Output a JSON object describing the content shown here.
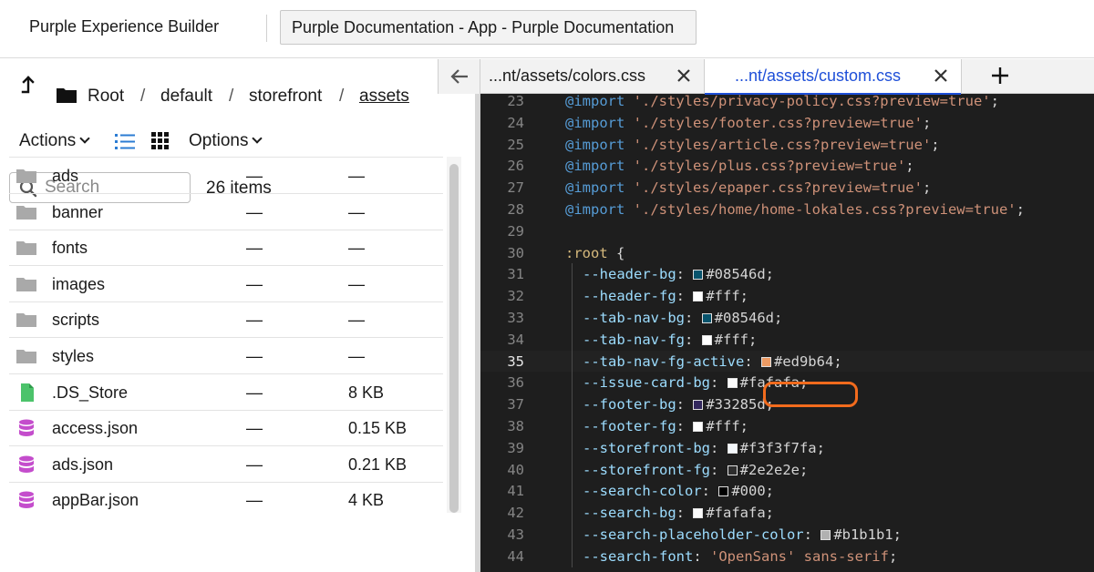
{
  "header": {
    "app_title": "Purple Experience Builder",
    "document_tab": "Purple Documentation - App - Purple Documentation"
  },
  "breadcrumb": [
    "Root",
    "default",
    "storefront",
    "assets"
  ],
  "toolbar": {
    "actions_label": "Actions",
    "options_label": "Options"
  },
  "search": {
    "placeholder": "Search",
    "value": "",
    "items_count": "26 items"
  },
  "files": [
    {
      "name": "ads",
      "type": "folder",
      "modified": "—",
      "size": "—"
    },
    {
      "name": "banner",
      "type": "folder",
      "modified": "—",
      "size": "—"
    },
    {
      "name": "fonts",
      "type": "folder",
      "modified": "—",
      "size": "—"
    },
    {
      "name": "images",
      "type": "folder",
      "modified": "—",
      "size": "—"
    },
    {
      "name": "scripts",
      "type": "folder",
      "modified": "—",
      "size": "—"
    },
    {
      "name": "styles",
      "type": "folder",
      "modified": "—",
      "size": "—"
    },
    {
      "name": ".DS_Store",
      "type": "file",
      "modified": "—",
      "size": "8 KB"
    },
    {
      "name": "access.json",
      "type": "data",
      "modified": "—",
      "size": "0.15 KB"
    },
    {
      "name": "ads.json",
      "type": "data",
      "modified": "—",
      "size": "0.21 KB"
    },
    {
      "name": "appBar.json",
      "type": "data",
      "modified": "—",
      "size": "4 KB"
    }
  ],
  "editor": {
    "tabs": [
      {
        "label": "...nt/assets/colors.css",
        "active": false
      },
      {
        "label": "...nt/assets/custom.css",
        "active": true
      }
    ],
    "current_line": 35,
    "lines": [
      {
        "n": "23",
        "kind": "import",
        "path": "'./styles/privacy-policy.css?preview=true'"
      },
      {
        "n": "24",
        "kind": "import",
        "path": "'./styles/footer.css?preview=true'"
      },
      {
        "n": "25",
        "kind": "import",
        "path": "'./styles/article.css?preview=true'"
      },
      {
        "n": "26",
        "kind": "import",
        "path": "'./styles/plus.css?preview=true'"
      },
      {
        "n": "27",
        "kind": "import",
        "path": "'./styles/epaper.css?preview=true'"
      },
      {
        "n": "28",
        "kind": "import",
        "path": "'./styles/home/home-lokales.css?preview=true'"
      },
      {
        "n": "29",
        "kind": "blank"
      },
      {
        "n": "30",
        "kind": "root"
      },
      {
        "n": "31",
        "kind": "var",
        "prop": "--header-bg",
        "value": "#08546d",
        "swatch": "#08546d"
      },
      {
        "n": "32",
        "kind": "var",
        "prop": "--header-fg",
        "value": "#fff",
        "swatch": "#ffffff"
      },
      {
        "n": "33",
        "kind": "var",
        "prop": "--tab-nav-bg",
        "value": "#08546d",
        "swatch": "#08546d"
      },
      {
        "n": "34",
        "kind": "var",
        "prop": "--tab-nav-fg",
        "value": "#fff",
        "swatch": "#ffffff"
      },
      {
        "n": "35",
        "kind": "var",
        "prop": "--tab-nav-fg-active",
        "value": "#ed9b64",
        "swatch": "#ed9b64"
      },
      {
        "n": "36",
        "kind": "var",
        "prop": "--issue-card-bg",
        "value": "#fafafa",
        "swatch": "#fafafa"
      },
      {
        "n": "37",
        "kind": "var",
        "prop": "--footer-bg",
        "value": "#33285d",
        "swatch": "#33285d"
      },
      {
        "n": "38",
        "kind": "var",
        "prop": "--footer-fg",
        "value": "#fff",
        "swatch": "#ffffff"
      },
      {
        "n": "39",
        "kind": "var",
        "prop": "--storefront-bg",
        "value": "#f3f3f7fa",
        "swatch": "#f3f7fa"
      },
      {
        "n": "40",
        "kind": "var",
        "prop": "--storefront-fg",
        "value": "#2e2e2e",
        "swatch": "#2e2e2e"
      },
      {
        "n": "41",
        "kind": "var",
        "prop": "--search-color",
        "value": "#000",
        "swatch": "#000000"
      },
      {
        "n": "42",
        "kind": "var",
        "prop": "--search-bg",
        "value": "#fafafa",
        "swatch": "#fafafa"
      },
      {
        "n": "43",
        "kind": "var",
        "prop": "--search-placeholder-color",
        "value": "#b1b1b1",
        "swatch": "#b1b1b1"
      },
      {
        "n": "44",
        "kind": "font",
        "prop": "--search-font",
        "value": "'OpenSans' sans-serif"
      }
    ]
  },
  "icons": {
    "up": "arrow-up-icon",
    "folder": "folder-icon",
    "list": "list-view-icon",
    "grid": "grid-view-icon",
    "search": "search-icon",
    "collapse": "arrow-left-icon",
    "close": "close-icon",
    "add": "plus-icon"
  },
  "colors": {
    "accent_blue": "#1e4fd8",
    "highlight_ring": "#f26b1d",
    "editor_bg": "#1e1e1e"
  }
}
